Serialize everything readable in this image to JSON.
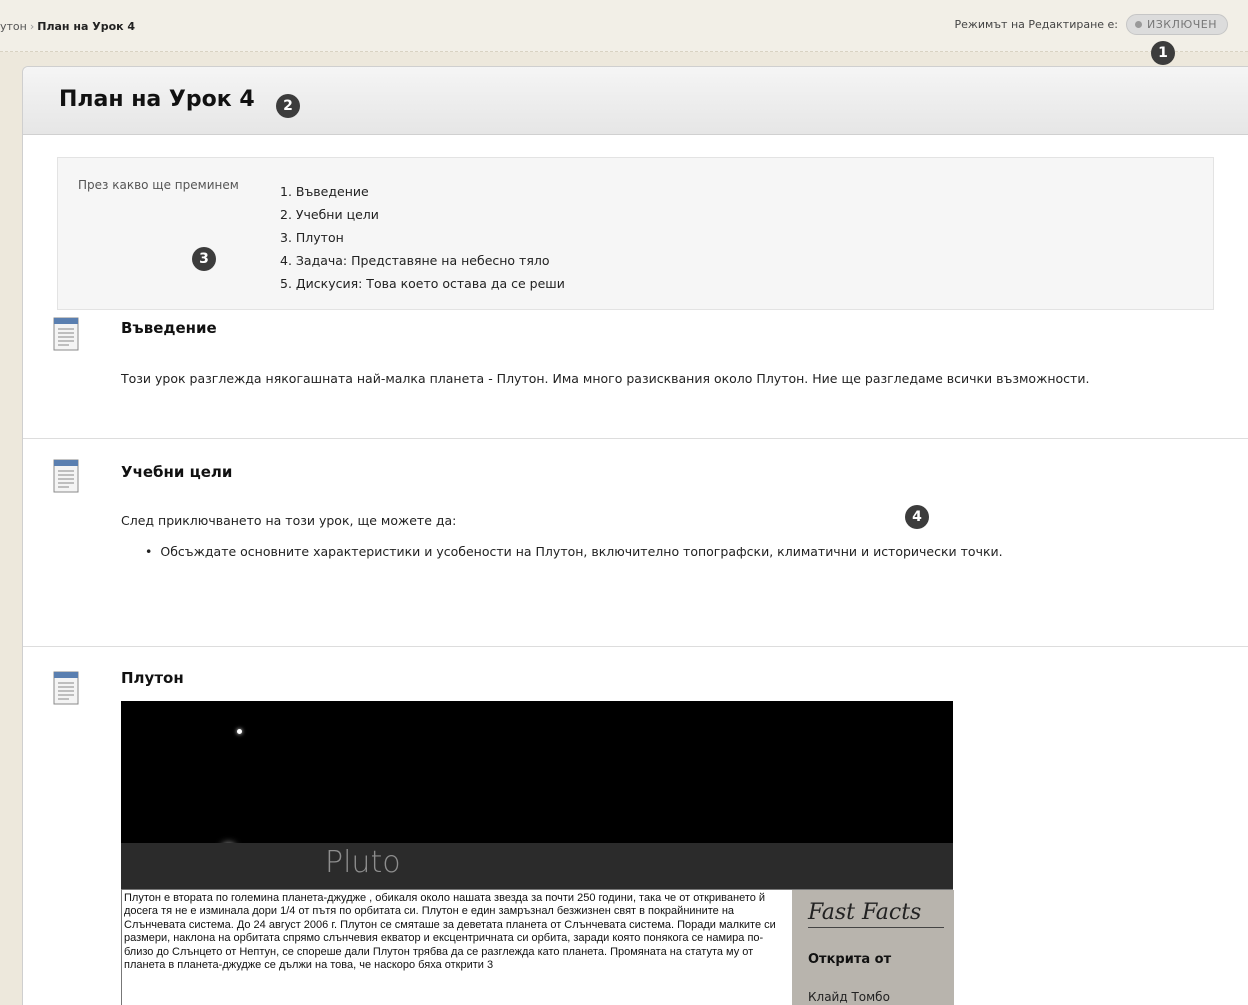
{
  "breadcrumb": {
    "parent": "утон",
    "separator": "›",
    "current": "План на Урок 4"
  },
  "edit_mode": {
    "label": "Режимът на Редактиране е:",
    "state": "ИЗКЛЮЧЕН"
  },
  "markers": [
    "1",
    "2",
    "3",
    "4"
  ],
  "page": {
    "title": "План на Урок 4"
  },
  "overview": {
    "label": "През какво ще преминем",
    "items": [
      "1. Въведение",
      "2. Учебни цели",
      "3. Плутон",
      "4. Задача: Представяне на небесно тяло",
      "5. Дискусия: Това което остава да се реши"
    ]
  },
  "sections": {
    "intro": {
      "title": "Въведение",
      "body": "Този урок разглежда някогашната най-малка планета - Плутон. Има много разисквания около Плутон. Ние ще разгледаме всички възможности."
    },
    "objectives": {
      "title": "Учебни цели",
      "body": "След приключването на този урок, ще можете да:",
      "bullets": [
        "Обсъждате основните характеристики и усобености на Плутон, включително топографски, климатични и исторически точки."
      ]
    },
    "pluto": {
      "title": "Плутон",
      "image_caption": "Pluto",
      "paragraph": "Плутон е втората по големина планета-джудже , обикаля около нашата звезда за почти 250 години, така че от откриването й досега тя не е изминала дори 1/4 от пътя по орбитата си. Плутон е един замръзнал безжизнен свят в покрайнините на Слънчевата система. До 24 август 2006 г. Плутон се смяташе за деветата планета от Слънчевата система. Поради малките си размери, наклона на орбитата спрямо слънчевия екватор и ексцентричната си орбита, заради която понякога се намира по-близо до Слънцето от Нептун, се спореше дали Плутон трябва да се разглежда като планета. Промяната на статута му от планета в планета-джудже се дължи на това, че наскоро бяха открити 3",
      "facts_title": "Fast Facts",
      "facts_label": "Открита от",
      "facts_value": "Клайд Томбо"
    }
  },
  "icons": {
    "item_icon": "document-icon"
  }
}
